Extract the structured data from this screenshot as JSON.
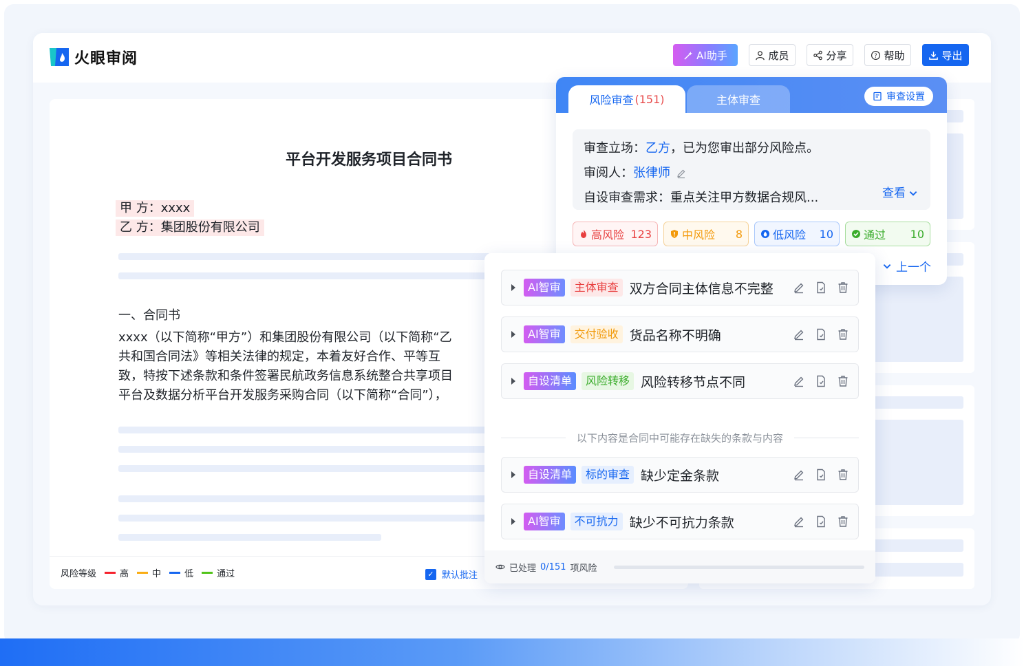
{
  "app": {
    "name": "火眼审阅"
  },
  "toolbar": {
    "ai_label": "AI助手",
    "members_label": "成员",
    "share_label": "分享",
    "help_label": "帮助",
    "export_label": "导出"
  },
  "document": {
    "title": "平台开发服务项目合同书",
    "party_a": "甲 方：xxxx",
    "party_b": "乙 方：集团股份有限公司",
    "section_title": "一、合同书",
    "paragraph_lines": [
      "xxxx（以下简称“甲方”）和集团股份有限公司（以下简称“乙",
      "共和国合同法》等相关法律的规定，本着友好合作、平等互",
      "致，特按下述条款和条件签署民航政务信息系统整合共享项目",
      "平台及数据分析平台开发服务采购合同（以下简称“合同”），"
    ]
  },
  "legend": {
    "label": "风险等级",
    "items": [
      {
        "label": "高",
        "color": "#f5222d"
      },
      {
        "label": "中",
        "color": "#faad14"
      },
      {
        "label": "低",
        "color": "#1566f0"
      },
      {
        "label": "通过",
        "color": "#52c41a"
      }
    ],
    "default_note": "默认批注"
  },
  "panel": {
    "tab_risk": "风险审查",
    "tab_risk_count": "(151)",
    "tab_subject": "主体审查",
    "settings_label": "审查设置",
    "stance_label": "审查立场：",
    "stance_value": "乙方",
    "stance_suffix": "，已为您审出部分风险点。",
    "reviewer_label": "审阅人：",
    "reviewer_value": "张律师",
    "custom_label": "自设审查需求：",
    "custom_value": "重点关注甲方数据合规风...",
    "view_label": "查看",
    "risks": [
      {
        "name": "高风险",
        "count": "123",
        "icon": "fire-icon"
      },
      {
        "name": "中风险",
        "count": "8",
        "icon": "shield-icon"
      },
      {
        "name": "低风险",
        "count": "10",
        "icon": "drop-icon"
      },
      {
        "name": "通过",
        "count": "10",
        "icon": "check-icon"
      }
    ],
    "prev_label": "上一个"
  },
  "issues": {
    "items": [
      {
        "source": "AI智审",
        "category": "主体审查",
        "title": "双方合同主体信息不完整"
      },
      {
        "source": "AI智审",
        "category": "交付验收",
        "title": "货品名称不明确"
      },
      {
        "source": "自设清单",
        "category": "风险转移",
        "title": "风险转移节点不同"
      }
    ],
    "missing_divider": "以下内容是合同中可能存在缺失的条款与内容",
    "missing": [
      {
        "source": "自设清单",
        "category": "标的审查",
        "title": "缺少定金条款"
      },
      {
        "source": "AI智审",
        "category": "不可抗力",
        "title": "缺少不可抗力条款"
      }
    ],
    "footer_prefix": "已处理",
    "footer_progress": "0/151",
    "footer_suffix": "项风险",
    "progress_fraction": 0
  }
}
